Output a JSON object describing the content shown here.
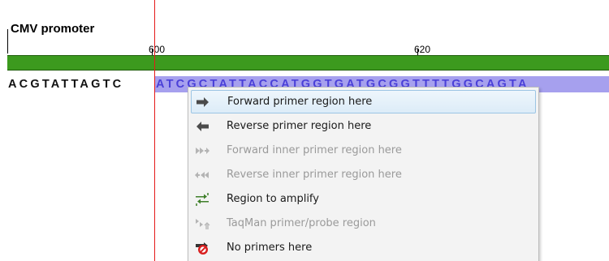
{
  "annotation": {
    "label": "CMV promoter"
  },
  "ruler": {
    "positions": [
      "600",
      "620"
    ]
  },
  "sequence": {
    "unselected": "ACGTATTAGTC",
    "selected": "ATCGCTATTACCATGGTGATGCGGTTTTGGCAGTA"
  },
  "colors": {
    "track_green": "#3c9a1e",
    "selection_purple": "#a6a0ee",
    "selected_text": "#4a40d8",
    "cursor_red": "#e41a1a"
  },
  "context_menu": {
    "items": [
      {
        "label": "Forward primer region here",
        "icon": "forward-arrow-icon",
        "enabled": true,
        "highlighted": true
      },
      {
        "label": "Reverse primer region here",
        "icon": "reverse-arrow-icon",
        "enabled": true,
        "highlighted": false
      },
      {
        "label": "Forward inner primer region here",
        "icon": "forward-inner-icon",
        "enabled": false,
        "highlighted": false
      },
      {
        "label": "Reverse inner primer region here",
        "icon": "reverse-inner-icon",
        "enabled": false,
        "highlighted": false
      },
      {
        "label": "Region to amplify",
        "icon": "amplify-region-icon",
        "enabled": true,
        "highlighted": false
      },
      {
        "label": "TaqMan primer/probe region",
        "icon": "taqman-icon",
        "enabled": false,
        "highlighted": false
      },
      {
        "label": "No primers here",
        "icon": "no-primers-icon",
        "enabled": true,
        "highlighted": false
      }
    ]
  }
}
